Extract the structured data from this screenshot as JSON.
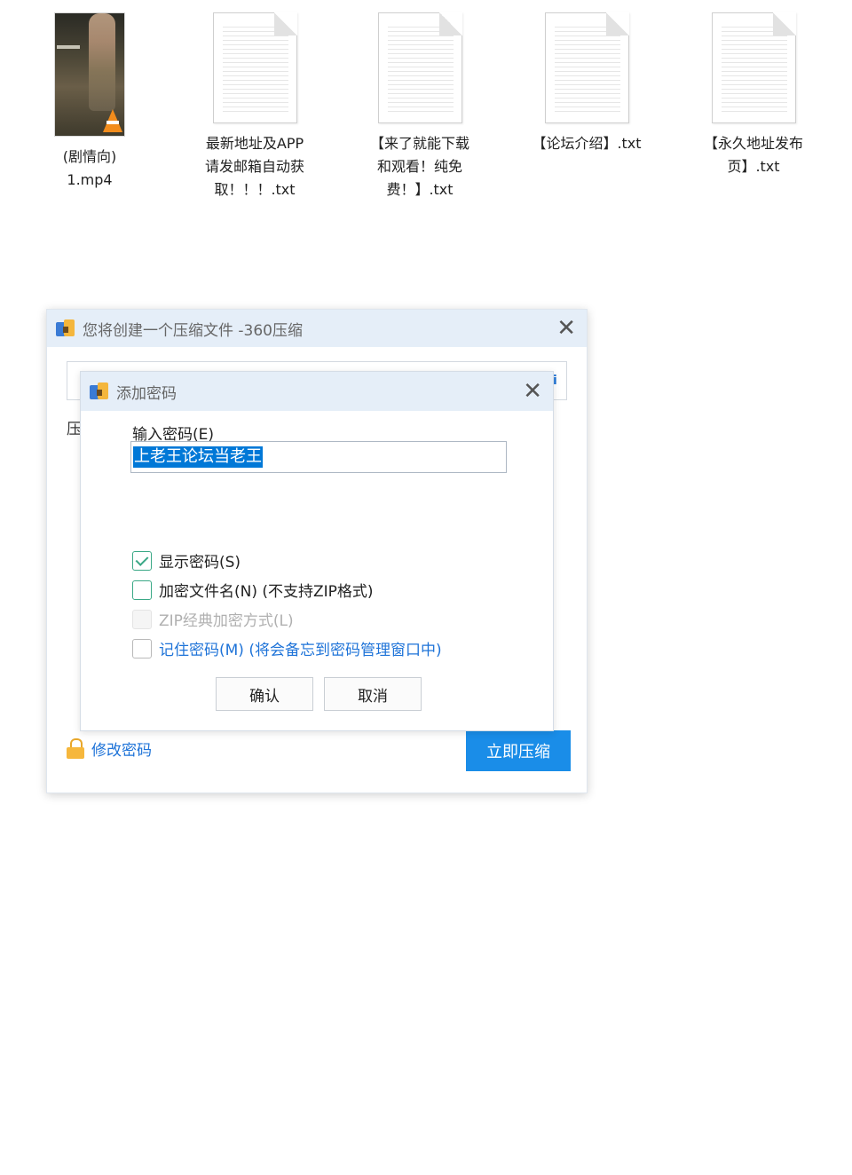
{
  "files": [
    {
      "name": "(剧情向)\n1.mp4",
      "type": "video"
    },
    {
      "name": "最新地址及APP\n请发邮箱自动获\n取！！！.txt",
      "type": "txt"
    },
    {
      "name": "【来了就能下载\n和观看！纯免\n费！】.txt",
      "type": "txt"
    },
    {
      "name": "【论坛介绍】.txt",
      "type": "txt"
    },
    {
      "name": "【永久地址发布\n页】.txt",
      "type": "txt"
    }
  ],
  "main_dialog": {
    "title": "您将创建一个压缩文件 -360压缩",
    "bg_label": "压",
    "bg_sidechar": "i",
    "change_password_link": "修改密码",
    "compress_button": "立即压缩"
  },
  "password_dialog": {
    "title": "添加密码",
    "input_label": "输入密码(E)",
    "password_value": "上老王论坛当老王",
    "show_password": {
      "label": "显示密码(S)",
      "checked": true
    },
    "encrypt_filenames": {
      "label": "加密文件名(N) (不支持ZIP格式)",
      "checked": false
    },
    "zip_classic": {
      "label": "ZIP经典加密方式(L)",
      "checked": false,
      "disabled": true
    },
    "remember_password": {
      "label": "记住密码(M) (将会备忘到密码管理窗口中)",
      "checked": false
    },
    "ok_button": "确认",
    "cancel_button": "取消"
  },
  "colors": {
    "accent": "#1a8de8",
    "link": "#1e73d8",
    "titlebar": "#e5eef8",
    "check": "#3aa886",
    "selection": "#0078d7"
  }
}
